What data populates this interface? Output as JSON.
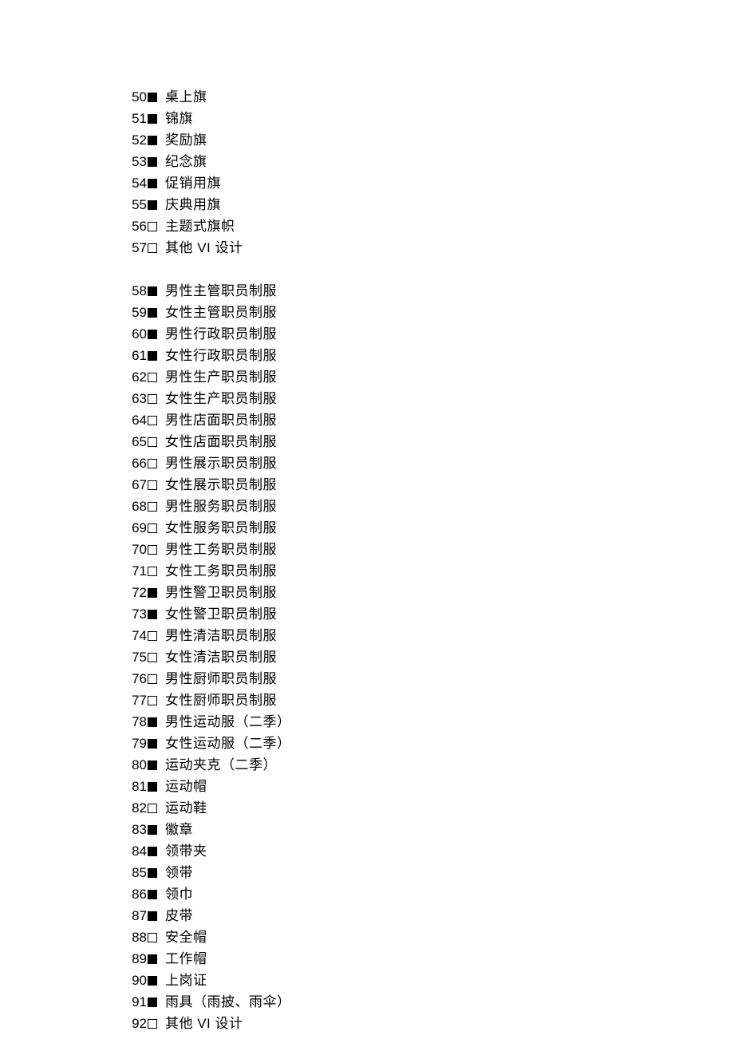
{
  "items": [
    {
      "num": "50",
      "checked": true,
      "label": "桌上旗"
    },
    {
      "num": "51",
      "checked": true,
      "label": "锦旗"
    },
    {
      "num": "52",
      "checked": true,
      "label": "奖励旗"
    },
    {
      "num": "53",
      "checked": true,
      "label": "纪念旗"
    },
    {
      "num": "54",
      "checked": true,
      "label": "促销用旗"
    },
    {
      "num": "55",
      "checked": true,
      "label": "庆典用旗"
    },
    {
      "num": "56",
      "checked": false,
      "label": "主题式旗帜"
    },
    {
      "num": "57",
      "checked": false,
      "label": "其他 VI 设计"
    },
    {
      "gap": true
    },
    {
      "num": "58",
      "checked": true,
      "label": "男性主管职员制服"
    },
    {
      "num": "59",
      "checked": true,
      "label": "女性主管职员制服"
    },
    {
      "num": "60",
      "checked": true,
      "label": "男性行政职员制服"
    },
    {
      "num": "61",
      "checked": true,
      "label": "女性行政职员制服"
    },
    {
      "num": "62",
      "checked": false,
      "label": "男性生产职员制服"
    },
    {
      "num": "63",
      "checked": false,
      "label": "女性生产职员制服"
    },
    {
      "num": "64",
      "checked": false,
      "label": "男性店面职员制服"
    },
    {
      "num": "65",
      "checked": false,
      "label": "女性店面职员制服"
    },
    {
      "num": "66",
      "checked": false,
      "label": "男性展示职员制服"
    },
    {
      "num": "67",
      "checked": false,
      "label": "女性展示职员制服"
    },
    {
      "num": "68",
      "checked": false,
      "label": "男性服务职员制服"
    },
    {
      "num": "69",
      "checked": false,
      "label": "女性服务职员制服"
    },
    {
      "num": "70",
      "checked": false,
      "label": "男性工务职员制服"
    },
    {
      "num": "71",
      "checked": false,
      "label": "女性工务职员制服"
    },
    {
      "num": "72",
      "checked": true,
      "label": "男性警卫职员制服"
    },
    {
      "num": "73",
      "checked": true,
      "label": "女性警卫职员制服"
    },
    {
      "num": "74",
      "checked": false,
      "label": "男性清洁职员制服"
    },
    {
      "num": "75",
      "checked": false,
      "label": "女性清洁职员制服"
    },
    {
      "num": "76",
      "checked": false,
      "label": "男性厨师职员制服"
    },
    {
      "num": "77",
      "checked": false,
      "label": "女性厨师职员制服"
    },
    {
      "num": "78",
      "checked": true,
      "label": "男性运动服（二季）"
    },
    {
      "num": "79",
      "checked": true,
      "label": "女性运动服（二季）"
    },
    {
      "num": "80",
      "checked": true,
      "label": "运动夹克（二季）"
    },
    {
      "num": "81",
      "checked": true,
      "label": "运动帽"
    },
    {
      "num": "82",
      "checked": false,
      "label": "运动鞋"
    },
    {
      "num": "83",
      "checked": true,
      "label": "徽章"
    },
    {
      "num": "84",
      "checked": true,
      "label": "领带夹"
    },
    {
      "num": "85",
      "checked": true,
      "label": "领带"
    },
    {
      "num": "86",
      "checked": true,
      "label": "领巾"
    },
    {
      "num": "87",
      "checked": true,
      "label": "皮带"
    },
    {
      "num": "88",
      "checked": false,
      "label": "安全帽"
    },
    {
      "num": "89",
      "checked": true,
      "label": "工作帽"
    },
    {
      "num": "90",
      "checked": true,
      "label": "上岗证"
    },
    {
      "num": "91",
      "checked": true,
      "label": "雨具（雨披、雨伞）"
    },
    {
      "num": "92",
      "checked": false,
      "label": "其他 VI 设计"
    }
  ]
}
